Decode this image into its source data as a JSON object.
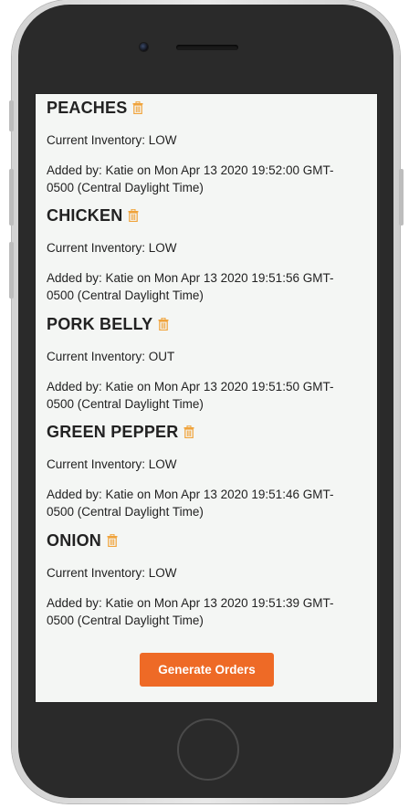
{
  "items": [
    {
      "name": "PEACHES",
      "inventory": "Current Inventory: LOW",
      "added_line1": "Added by: Katie on Mon Apr 13 2020 19:52:00 GMT-",
      "added_line2": "0500 (Central Daylight Time)"
    },
    {
      "name": "CHICKEN",
      "inventory": "Current Inventory: LOW",
      "added_line1": "Added by: Katie on Mon Apr 13 2020 19:51:56 GMT-",
      "added_line2": "0500 (Central Daylight Time)"
    },
    {
      "name": "PORK BELLY",
      "inventory": "Current Inventory: OUT",
      "added_line1": "Added by: Katie on Mon Apr 13 2020 19:51:50 GMT-",
      "added_line2": "0500 (Central Daylight Time)"
    },
    {
      "name": "GREEN PEPPER",
      "inventory": "Current Inventory: LOW",
      "added_line1": "Added by: Katie on Mon Apr 13 2020 19:51:46 GMT-",
      "added_line2": "0500 (Central Daylight Time)"
    },
    {
      "name": "ONION",
      "inventory": "Current Inventory: LOW",
      "added_line1": "Added by: Katie on Mon Apr 13 2020 19:51:39 GMT-",
      "added_line2": "0500 (Central Daylight Time)"
    }
  ],
  "actions": {
    "generate_orders_label": "Generate Orders"
  },
  "icons": {
    "delete": "trash-icon"
  },
  "colors": {
    "accent": "#ee6a26",
    "trash": "#f0a33a",
    "screen_bg": "#f4f6f4"
  }
}
